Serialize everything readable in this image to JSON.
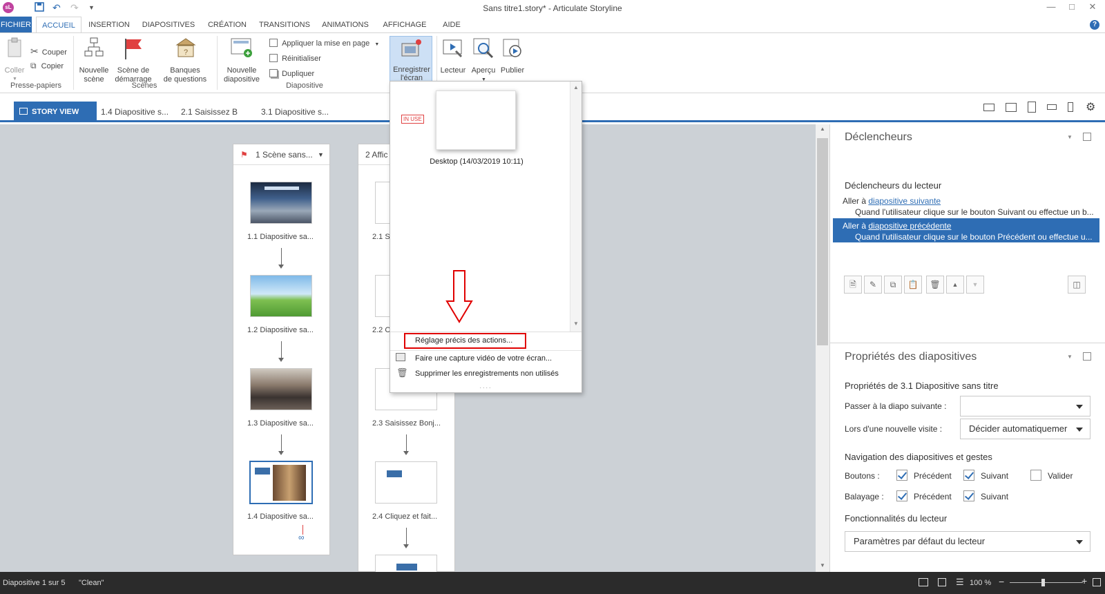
{
  "window": {
    "title": "Sans titre1.story* - Articulate Storyline",
    "logo": "sL"
  },
  "ribbon_tabs": [
    "FICHIER",
    "ACCUEIL",
    "INSERTION",
    "DIAPOSITIVES",
    "CRÉATION",
    "TRANSITIONS",
    "ANIMATIONS",
    "AFFICHAGE",
    "AIDE"
  ],
  "ribbon": {
    "coller": "Coller",
    "couper": "Couper",
    "copier": "Copier",
    "presse_papiers": "Presse-papiers",
    "nouvelle_scene": [
      "Nouvelle",
      "scène"
    ],
    "scene_demarrage": [
      "Scène de",
      "démarrage"
    ],
    "banques": [
      "Banques",
      "de questions"
    ],
    "scenes_group": "Scènes",
    "nouvelle_diapo": [
      "Nouvelle",
      "diapositive"
    ],
    "appliquer": "Appliquer la mise en page",
    "reinitialiser": "Réinitialiser",
    "dupliquer": "Dupliquer",
    "diapositive_group": "Diapositive",
    "enregistrer": [
      "Enregistrer",
      "l'écran"
    ],
    "lecteur": "Lecteur",
    "apercu": "Aperçu",
    "publier": "Publier"
  },
  "story_tabs": [
    "STORY VIEW",
    "1.4 Diapositive s...",
    "2.1 Saisissez B",
    "3.1 Diapositive s..."
  ],
  "scenes": [
    {
      "title": "1 Scène sans...",
      "slides": [
        "1.1 Diapositive sa...",
        "1.2 Diapositive sa...",
        "1.3 Diapositive sa...",
        "1.4 Diapositive sa..."
      ]
    },
    {
      "title": "2 Affic",
      "slides": [
        "2.1 Sa",
        "2.2 C",
        "2.3 Saisissez Bonj...",
        "2.4 Cliquez et fait..."
      ]
    }
  ],
  "dropdown": {
    "badge": "IN USE",
    "recording": "Desktop (14/03/2019 10:11)",
    "items": [
      "Réglage précis des actions...",
      "Faire une capture vidéo de votre écran...",
      "Supprimer les enregistrements non utilisés"
    ],
    "grip": "...."
  },
  "triggers": {
    "title": "Déclencheurs",
    "section": "Déclencheurs du lecteur",
    "items": [
      {
        "prefix": "Aller à",
        "link": "diapositive suivante",
        "desc": "Quand l'utilisateur clique sur le bouton Suivant ou effectue un b..."
      },
      {
        "prefix": "Aller à",
        "link": "diapositive précédente",
        "desc": "Quand l'utilisateur clique sur le bouton Précédent ou effectue u..."
      }
    ]
  },
  "properties": {
    "title": "Propriétés des diapositives",
    "slide_title": "Propriétés de 3.1 Diapositive sans titre",
    "next_label": "Passer à la diapo suivante :",
    "next_value": "",
    "revisit_label": "Lors d'une nouvelle visite :",
    "revisit_value": "Décider automatiquemer",
    "nav_title": "Navigation des diapositives et gestes",
    "buttons_label": "Boutons :",
    "swipe_label": "Balayage :",
    "prev": "Précédent",
    "next": "Suivant",
    "submit": "Valider",
    "player_title": "Fonctionnalités du lecteur",
    "player_value": "Paramètres par défaut du lecteur"
  },
  "status": {
    "slide": "Diapositive 1 sur 5",
    "theme": "\"Clean\"",
    "zoom": "100 %"
  },
  "colors": {
    "accent": "#2e6db4",
    "highlight": "#e00000",
    "canvas": "#ccd1d6"
  }
}
